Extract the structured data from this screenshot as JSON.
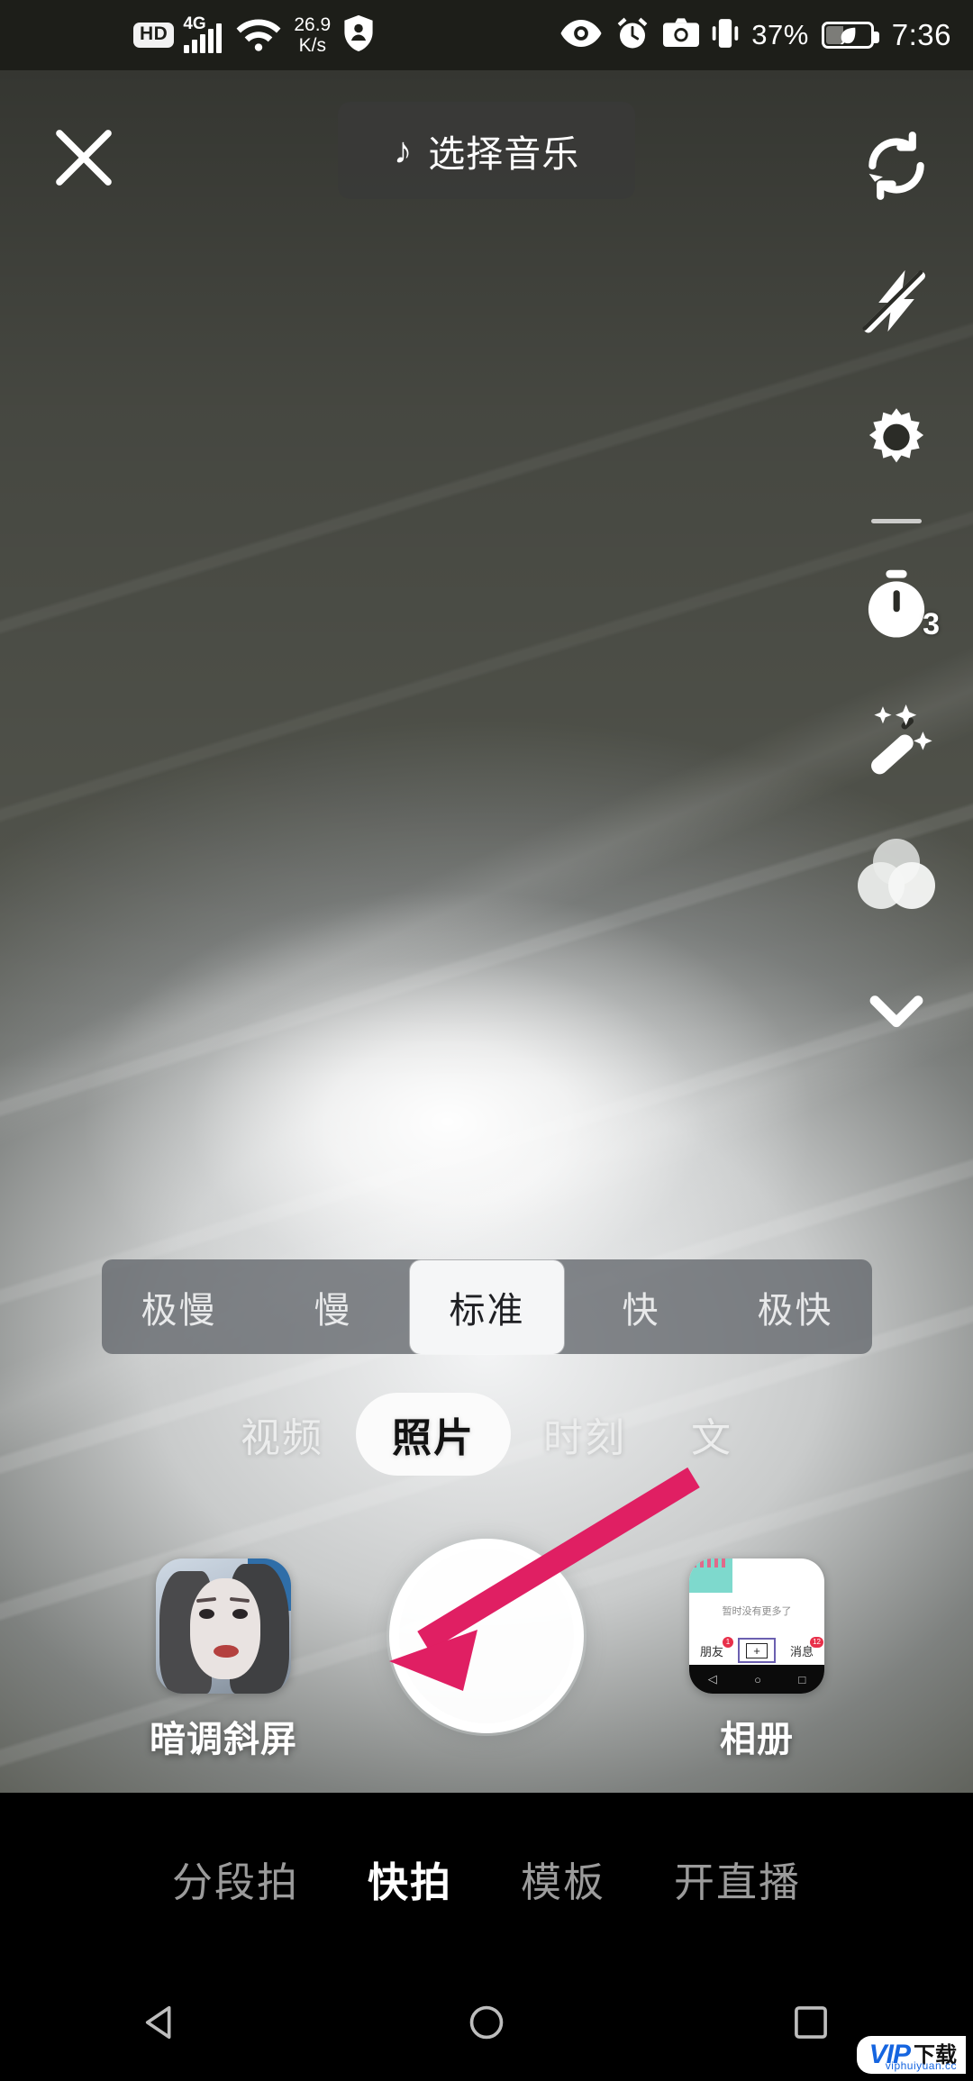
{
  "status_bar": {
    "hd_badge": "HD",
    "network_type": "4G",
    "net_speed_value": "26.9",
    "net_speed_unit": "K/s",
    "icons": [
      "hd-badge",
      "signal-bars-icon",
      "wifi-icon",
      "shield-icon",
      "eye-icon",
      "alarm-icon",
      "camera-icon",
      "vibrate-icon"
    ],
    "battery_percent": "37%",
    "battery_level": 37,
    "battery_icon": "battery-saver-leaf-icon",
    "time": "7:36"
  },
  "top_bar": {
    "close_icon": "close-icon",
    "music_button": {
      "label": "选择音乐",
      "icon": "music-note-icon"
    }
  },
  "right_rail": {
    "items": [
      {
        "name": "flip-camera",
        "icon": "flip-camera-icon",
        "label": ""
      },
      {
        "name": "flash-off",
        "icon": "flash-off-icon",
        "label": ""
      },
      {
        "name": "settings",
        "icon": "gear-icon",
        "label": ""
      },
      {
        "name": "timer",
        "icon": "timer-icon",
        "badge": "3"
      },
      {
        "name": "beauty",
        "icon": "magic-wand-icon",
        "label": ""
      },
      {
        "name": "filters",
        "icon": "filter-circles-icon",
        "label": ""
      },
      {
        "name": "collapse",
        "icon": "chevron-down-icon",
        "label": ""
      }
    ]
  },
  "speed_selector": {
    "options": [
      {
        "label": "极慢",
        "selected": false
      },
      {
        "label": "慢",
        "selected": false
      },
      {
        "label": "标准",
        "selected": true
      },
      {
        "label": "快",
        "selected": false
      },
      {
        "label": "极快",
        "selected": false
      }
    ]
  },
  "mode_tabs": {
    "tabs": [
      {
        "label": "视频",
        "selected": false
      },
      {
        "label": "照片",
        "selected": true
      },
      {
        "label": "时刻",
        "selected": false
      },
      {
        "label": "文",
        "selected": false
      }
    ]
  },
  "capture_row": {
    "effect_label": "暗调斜屏",
    "shutter_name": "shutter-button",
    "album_label": "相册",
    "album_thumb": {
      "note": "暂时没有更多了",
      "tab_left": "朋友",
      "tab_left_badge": "1",
      "tab_right": "消息",
      "tab_right_badge": "12",
      "center_icon": "plus-icon"
    }
  },
  "annotation": {
    "arrow_color": "#e01f63",
    "arrow_points_to": "shutter-button"
  },
  "bottom_nav": {
    "items": [
      {
        "label": "分段拍",
        "selected": false
      },
      {
        "label": "快拍",
        "selected": true
      },
      {
        "label": "模板",
        "selected": false
      },
      {
        "label": "开直播",
        "selected": false
      }
    ]
  },
  "android_nav": {
    "back": "back-triangle-icon",
    "home": "home-circle-icon",
    "recents": "recents-square-icon"
  },
  "watermark": {
    "vip": "VIP",
    "cn": "下载",
    "url": "viphuiyuan.cc"
  }
}
